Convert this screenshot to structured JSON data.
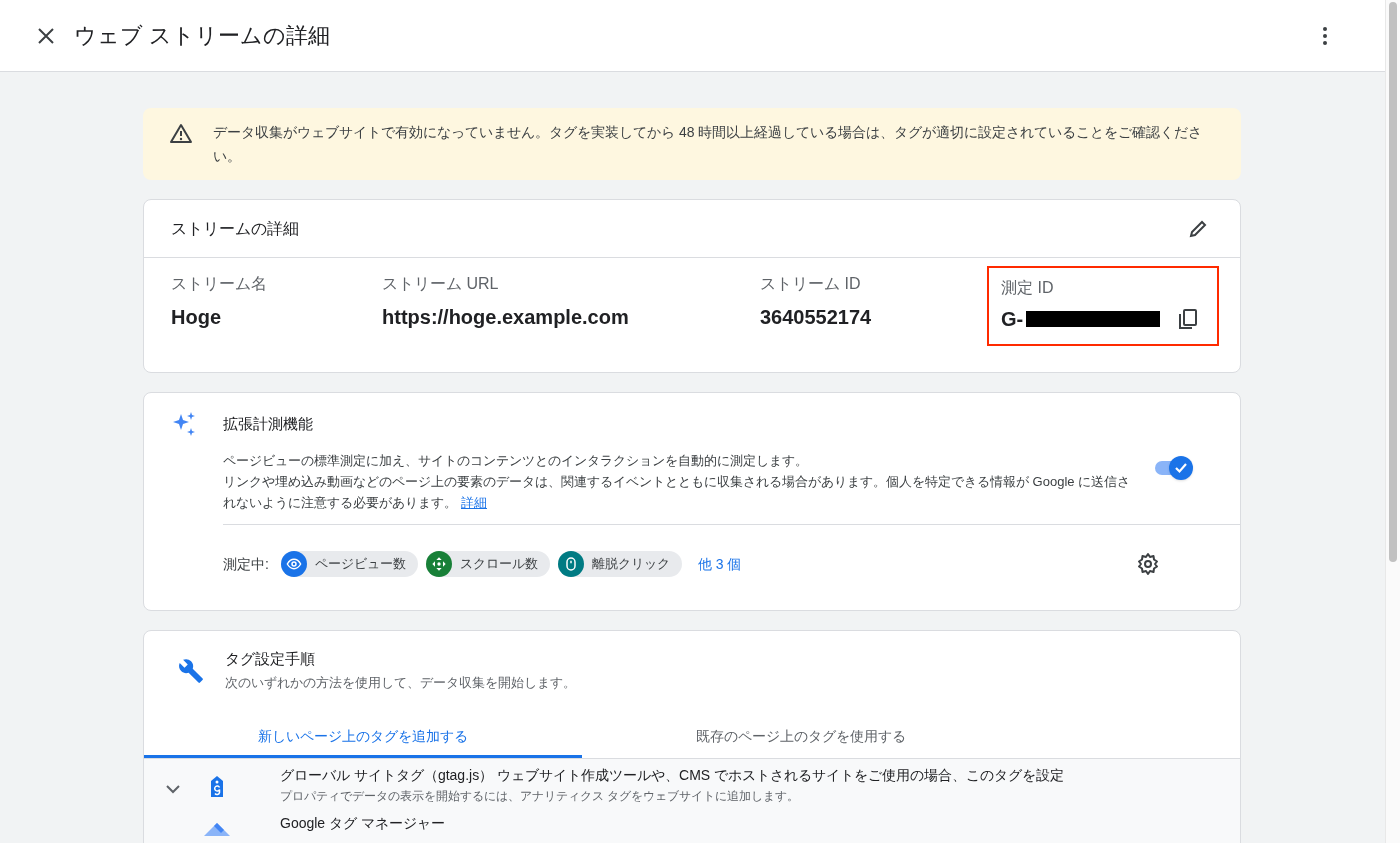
{
  "header": {
    "title": "ウェブ ストリームの詳細"
  },
  "alert": {
    "text": "データ収集がウェブサイトで有効になっていません。タグを実装してから 48 時間以上経過している場合は、タグが適切に設定されていることをご確認ください。"
  },
  "stream_details": {
    "title": "ストリームの詳細",
    "fields": [
      {
        "label": "ストリーム名",
        "value": "Hoge",
        "kind": "plain"
      },
      {
        "label": "ストリーム URL",
        "value": "https://hoge.example.com",
        "kind": "plain"
      },
      {
        "label": "ストリーム ID",
        "value": "3640552174",
        "kind": "plain"
      },
      {
        "label": "測定 ID",
        "value": "G-",
        "kind": "redacted"
      }
    ]
  },
  "enhanced_measurement": {
    "title": "拡張計測機能",
    "description": "ページビューの標準測定に加え、サイトのコンテンツとのインタラクションを自動的に測定します。",
    "note": "リンクや埋め込み動画などのページ上の要素のデータは、関連するイベントとともに収集される場合があります。個人を特定できる情報が Google に送信されないように注意する必要があります。",
    "link": "詳細",
    "on": true,
    "measuring_label": "測定中:",
    "chips": [
      {
        "label": "ページビュー数",
        "kind": "eye",
        "color": "#1a73e8"
      },
      {
        "label": "スクロール数",
        "kind": "scroll",
        "color": "#188038"
      },
      {
        "label": "離脱クリック",
        "kind": "mouse",
        "color": "#007b83"
      }
    ],
    "more_link": "他 3 個"
  },
  "tag_setup": {
    "title": "タグ設定手順",
    "subtitle": "次のいずれかの方法を使用して、データ収集を開始します。",
    "tabs": [
      {
        "label": "新しいページ上のタグを追加する",
        "selected": true
      },
      {
        "label": "既存のページ上のタグを使用する",
        "selected": false
      }
    ],
    "options": [
      {
        "title": "グローバル サイトタグ（gtag.js） ウェブサイト作成ツールや、CMS でホストされるサイトをご使用の場合、このタグを設定",
        "description": "プロパティでデータの表示を開始するには、アナリティクス タグをウェブサイトに追加します。",
        "kind": "gtag"
      },
      {
        "title": "Google タグ マネージャー",
        "kind": "gtm"
      }
    ]
  }
}
